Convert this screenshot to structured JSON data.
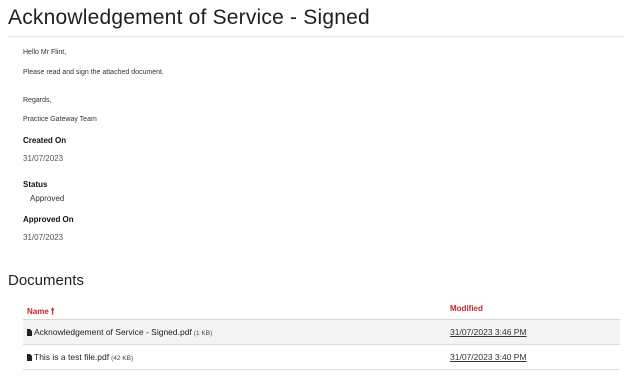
{
  "page": {
    "title": "Acknowledgement of Service - Signed"
  },
  "message": {
    "greeting": "Hello Mr Flint,",
    "body": "Please read and sign the attached document.",
    "regards": "Regards,",
    "signature": "Practice Gateway Team"
  },
  "fields": {
    "created_on_label": "Created On",
    "created_on_value": "31/07/2023",
    "status_label": "Status",
    "status_value": "Approved",
    "approved_on_label": "Approved On",
    "approved_on_value": "31/07/2023"
  },
  "documents": {
    "title": "Documents",
    "headers": {
      "name": "Name",
      "name_sort_icon": "arrow-up-icon",
      "modified": "Modified"
    },
    "rows": [
      {
        "name": "Acknowledgement of Service - Signed.pdf",
        "size": "(1 KB)",
        "modified": "31/07/2023 3:46 PM",
        "icon": "file-icon"
      },
      {
        "name": "This is a test file.pdf",
        "size": "(42 KB)",
        "modified": "31/07/2023 3:40 PM",
        "icon": "file-icon"
      }
    ]
  },
  "colors": {
    "accent": "#c0282d",
    "row_shade": "#f4f4f4"
  }
}
